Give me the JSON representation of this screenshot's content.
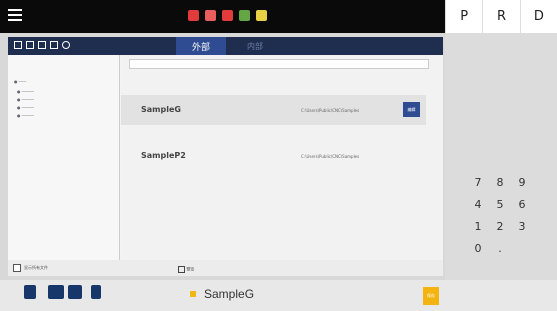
{
  "window": {
    "tab_external": "外部",
    "tab_internal": "内部"
  },
  "list": {
    "items": [
      {
        "name": "SampleG",
        "path": "C:\\Users\\Public\\CNC\\Samples",
        "action": "编辑"
      },
      {
        "name": "SampleP2",
        "path": "C:\\Users\\Public\\CNC\\Samples",
        "action": ""
      }
    ]
  },
  "footer": {
    "left_label": "显示所有文件",
    "checkbox_label": "预览"
  },
  "toolbar": {
    "p": "P",
    "r": "R",
    "d": "D"
  },
  "keypad": [
    "7",
    "8",
    "9",
    "4",
    "5",
    "6",
    "1",
    "2",
    "3",
    "0",
    "."
  ],
  "taskbar": {
    "active_file": "SampleG",
    "save": "保存"
  }
}
